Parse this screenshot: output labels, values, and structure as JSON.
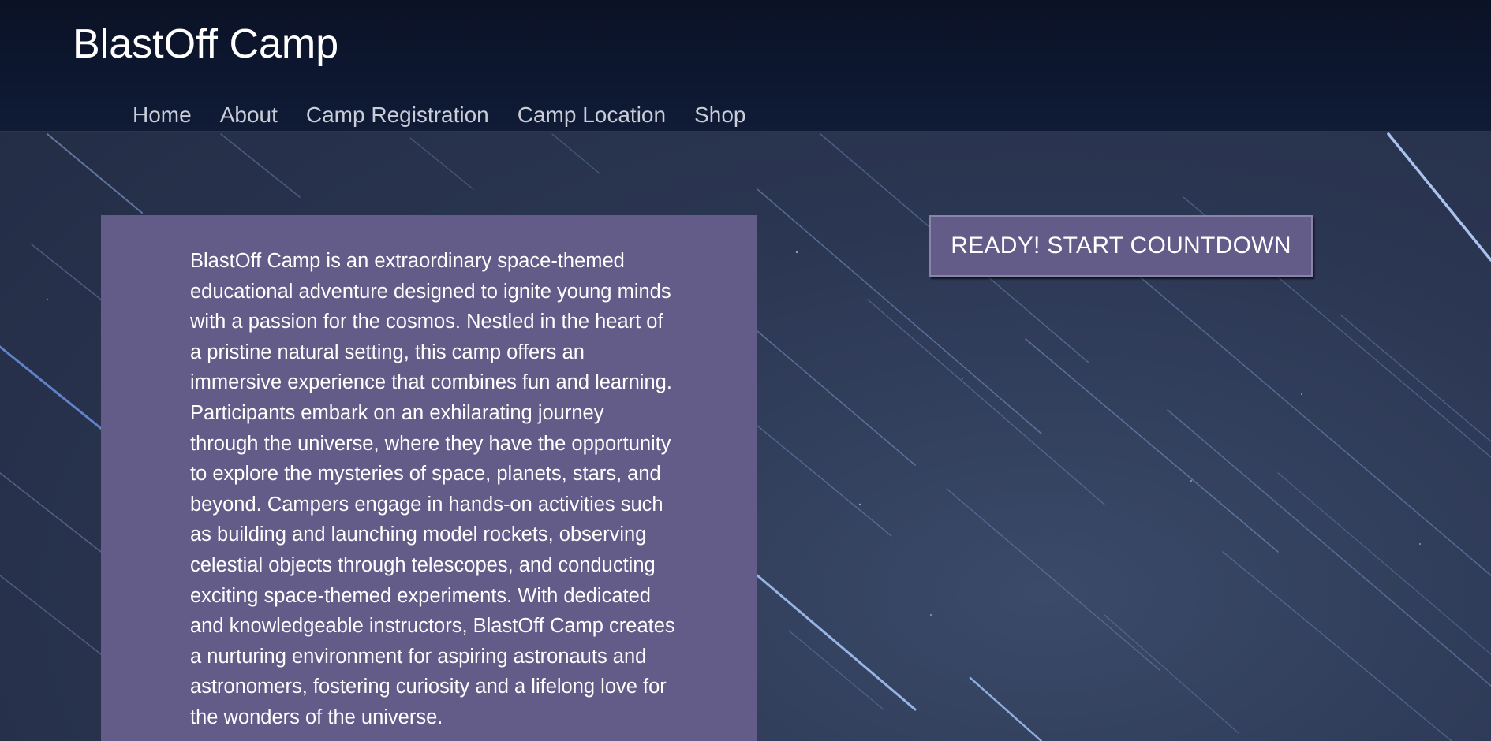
{
  "header": {
    "title": "BlastOff Camp",
    "nav": [
      "Home",
      "About",
      "Camp Registration",
      "Camp Location",
      "Shop"
    ]
  },
  "main": {
    "description": "BlastOff Camp is an extraordinary space-themed educational adventure designed to ignite young minds with a passion for the cosmos. Nestled in the heart of a pristine natural setting, this camp offers an immersive experience that combines fun and learning. Participants embark on an exhilarating journey through the universe, where they have the opportunity to explore the mysteries of space, planets, stars, and beyond. Campers engage in hands-on activities such as building and launching model rockets, observing celestial objects through telescopes, and conducting exciting space-themed experiments. With dedicated and knowledgeable instructors, BlastOff Camp creates a nurturing environment for aspiring astronauts and astronomers, fostering curiosity and a lifelong love for the wonders of the universe.",
    "countdown_button": "READY! START COUNTDOWN"
  },
  "colors": {
    "panel": "#635b88",
    "header_bg": "#0b1226",
    "nav_text": "#c9cdd8",
    "sky": "#2b3652"
  }
}
